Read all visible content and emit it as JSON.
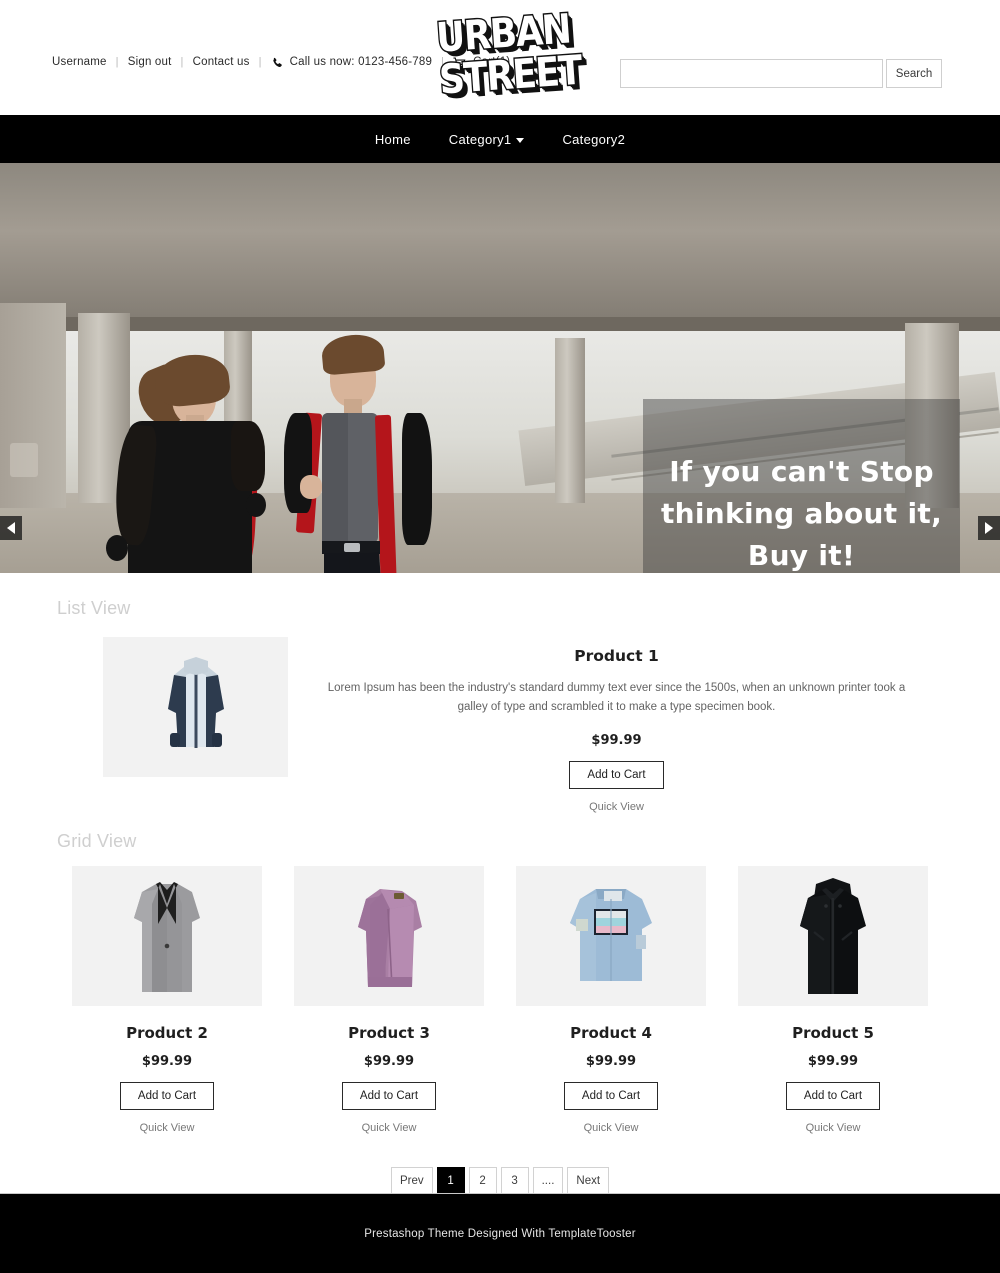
{
  "topbar": {
    "username": "Username",
    "signout": "Sign out",
    "contact": "Contact us",
    "phone_label": "Call us now: 0123-456-789",
    "cart_label": "Cart(1)",
    "separator": "|"
  },
  "logo": {
    "line1": "URBAN",
    "line2": "STREET"
  },
  "search": {
    "value": "",
    "placeholder": "",
    "button": "Search"
  },
  "nav": {
    "items": [
      {
        "label": "Home",
        "has_chevron": false
      },
      {
        "label": "Category1",
        "has_chevron": true
      },
      {
        "label": "Category2",
        "has_chevron": false
      }
    ]
  },
  "hero": {
    "caption": "If you can't Stop thinking about it, Buy it!",
    "prev_label": "previous slide",
    "next_label": "next slide"
  },
  "list_section": {
    "title": "List View",
    "product": {
      "name": "Product 1",
      "description": "Lorem Ipsum has been the industry's standard dummy text ever since the 1500s, when an unknown printer took a galley of type and scrambled it to make a type specimen book.",
      "price": "$99.99",
      "add_to_cart": "Add to Cart",
      "quick_view": "Quick View"
    }
  },
  "grid_section": {
    "title": "Grid View",
    "products": [
      {
        "name": "Product 2",
        "price": "$99.99",
        "add_to_cart": "Add to Cart",
        "quick_view": "Quick View"
      },
      {
        "name": "Product 3",
        "price": "$99.99",
        "add_to_cart": "Add to Cart",
        "quick_view": "Quick View"
      },
      {
        "name": "Product 4",
        "price": "$99.99",
        "add_to_cart": "Add to Cart",
        "quick_view": "Quick View"
      },
      {
        "name": "Product 5",
        "price": "$99.99",
        "add_to_cart": "Add to Cart",
        "quick_view": "Quick View"
      }
    ]
  },
  "pagination": {
    "prev": "Prev",
    "pages": [
      "1",
      "2",
      "3",
      "...."
    ],
    "active_page": "1",
    "next": "Next"
  },
  "footer": {
    "text": "Prestashop Theme Designed With TemplateTooster"
  },
  "colors": {
    "nav_bg": "#000000",
    "footer_bg": "#000000",
    "accent": "#000000",
    "section_title": "#cfcfcf",
    "thumb_bg": "#f2f2f2"
  }
}
